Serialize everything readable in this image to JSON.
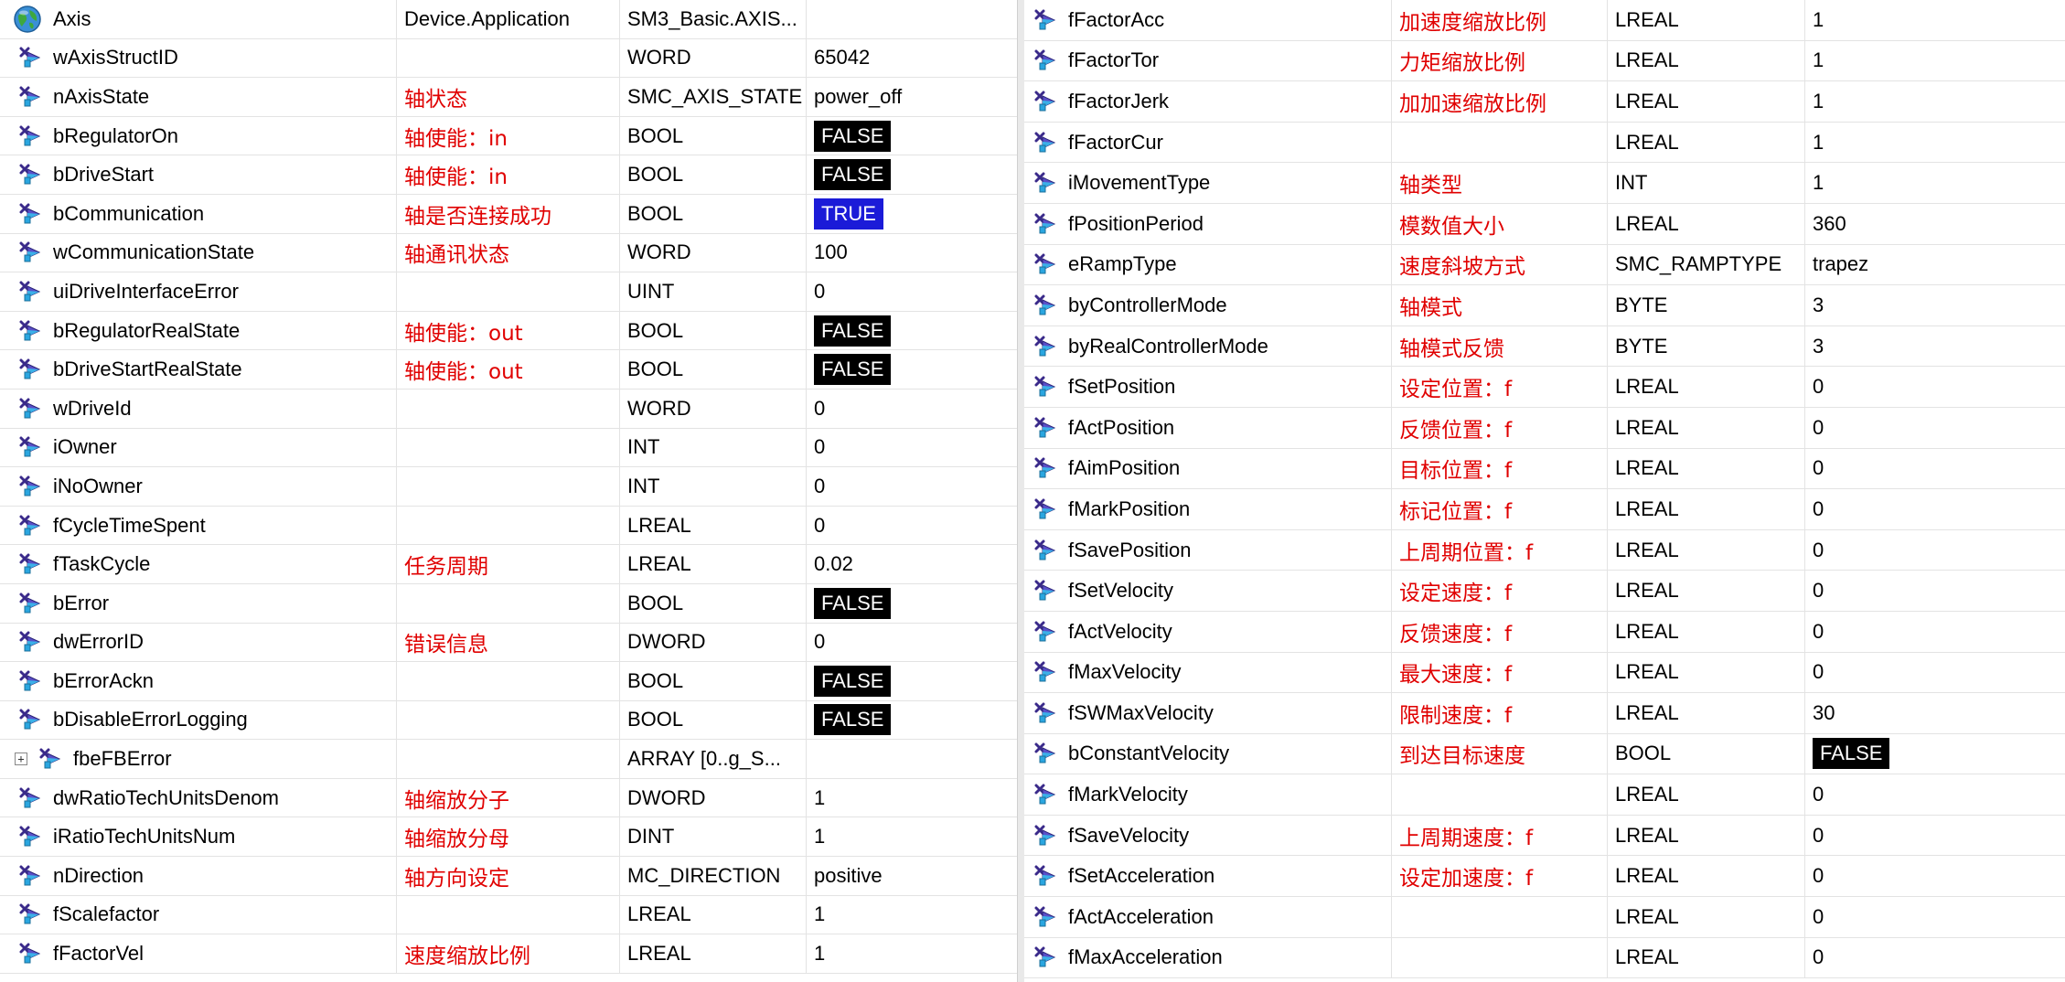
{
  "root": {
    "name": "Axis",
    "comment": "Device.Application",
    "type": "SM3_Basic.AXIS...",
    "value": ""
  },
  "left_rows": [
    {
      "name": "wAxisStructID",
      "comment": "",
      "type": "WORD",
      "value": "65042"
    },
    {
      "name": "nAxisState",
      "comment": "轴状态",
      "type": "SMC_AXIS_STATE",
      "value": "power_off"
    },
    {
      "name": "bRegulatorOn",
      "comment": "轴使能：in",
      "type": "BOOL",
      "value": "FALSE",
      "bool": "false"
    },
    {
      "name": "bDriveStart",
      "comment": "轴使能：in",
      "type": "BOOL",
      "value": "FALSE",
      "bool": "false"
    },
    {
      "name": "bCommunication",
      "comment": "轴是否连接成功",
      "type": "BOOL",
      "value": "TRUE",
      "bool": "true"
    },
    {
      "name": "wCommunicationState",
      "comment": "轴通讯状态",
      "type": "WORD",
      "value": "100"
    },
    {
      "name": "uiDriveInterfaceError",
      "comment": "",
      "type": "UINT",
      "value": "0"
    },
    {
      "name": "bRegulatorRealState",
      "comment": "轴使能：out",
      "type": "BOOL",
      "value": "FALSE",
      "bool": "false"
    },
    {
      "name": "bDriveStartRealState",
      "comment": "轴使能：out",
      "type": "BOOL",
      "value": "FALSE",
      "bool": "false"
    },
    {
      "name": "wDriveId",
      "comment": "",
      "type": "WORD",
      "value": "0"
    },
    {
      "name": "iOwner",
      "comment": "",
      "type": "INT",
      "value": "0"
    },
    {
      "name": "iNoOwner",
      "comment": "",
      "type": "INT",
      "value": "0"
    },
    {
      "name": "fCycleTimeSpent",
      "comment": "",
      "type": "LREAL",
      "value": "0"
    },
    {
      "name": "fTaskCycle",
      "comment": "任务周期",
      "type": "LREAL",
      "value": "0.02"
    },
    {
      "name": "bError",
      "comment": "",
      "type": "BOOL",
      "value": "FALSE",
      "bool": "false"
    },
    {
      "name": "dwErrorID",
      "comment": "错误信息",
      "type": "DWORD",
      "value": "0"
    },
    {
      "name": "bErrorAckn",
      "comment": "",
      "type": "BOOL",
      "value": "FALSE",
      "bool": "false"
    },
    {
      "name": "bDisableErrorLogging",
      "comment": "",
      "type": "BOOL",
      "value": "FALSE",
      "bool": "false"
    },
    {
      "name": "fbeFBError",
      "comment": "",
      "type": "ARRAY [0..g_S...",
      "value": "",
      "expander": "+"
    },
    {
      "name": "dwRatioTechUnitsDenom",
      "comment": "轴缩放分子",
      "type": "DWORD",
      "value": "1"
    },
    {
      "name": "iRatioTechUnitsNum",
      "comment": "轴缩放分母",
      "type": "DINT",
      "value": "1"
    },
    {
      "name": "nDirection",
      "comment": "轴方向设定",
      "type": "MC_DIRECTION",
      "value": "positive"
    },
    {
      "name": "fScalefactor",
      "comment": "",
      "type": "LREAL",
      "value": "1"
    },
    {
      "name": "fFactorVel",
      "comment": "速度缩放比例",
      "type": "LREAL",
      "value": "1"
    }
  ],
  "right_rows": [
    {
      "name": "fFactorAcc",
      "comment": "加速度缩放比例",
      "type": "LREAL",
      "value": "1"
    },
    {
      "name": "fFactorTor",
      "comment": "力矩缩放比例",
      "type": "LREAL",
      "value": "1"
    },
    {
      "name": "fFactorJerk",
      "comment": "加加速缩放比例",
      "type": "LREAL",
      "value": "1"
    },
    {
      "name": "fFactorCur",
      "comment": "",
      "type": "LREAL",
      "value": "1"
    },
    {
      "name": "iMovementType",
      "comment": "轴类型",
      "type": "INT",
      "value": "1"
    },
    {
      "name": "fPositionPeriod",
      "comment": "模数值大小",
      "type": "LREAL",
      "value": "360"
    },
    {
      "name": "eRampType",
      "comment": "速度斜坡方式",
      "type": "SMC_RAMPTYPE",
      "value": "trapez"
    },
    {
      "name": "byControllerMode",
      "comment": "轴模式",
      "type": "BYTE",
      "value": "3"
    },
    {
      "name": "byRealControllerMode",
      "comment": "轴模式反馈",
      "type": "BYTE",
      "value": "3"
    },
    {
      "name": "fSetPosition",
      "comment": "设定位置：f",
      "type": "LREAL",
      "value": "0"
    },
    {
      "name": "fActPosition",
      "comment": "反馈位置：f",
      "type": "LREAL",
      "value": "0"
    },
    {
      "name": "fAimPosition",
      "comment": "目标位置：f",
      "type": "LREAL",
      "value": "0"
    },
    {
      "name": "fMarkPosition",
      "comment": "标记位置：f",
      "type": "LREAL",
      "value": "0"
    },
    {
      "name": "fSavePosition",
      "comment": "上周期位置：f",
      "type": "LREAL",
      "value": "0"
    },
    {
      "name": "fSetVelocity",
      "comment": "设定速度：f",
      "type": "LREAL",
      "value": "0"
    },
    {
      "name": "fActVelocity",
      "comment": "反馈速度：f",
      "type": "LREAL",
      "value": "0"
    },
    {
      "name": "fMaxVelocity",
      "comment": "最大速度：f",
      "type": "LREAL",
      "value": "0"
    },
    {
      "name": "fSWMaxVelocity",
      "comment": "限制速度：f",
      "type": "LREAL",
      "value": "30"
    },
    {
      "name": "bConstantVelocity",
      "comment": "到达目标速度",
      "type": "BOOL",
      "value": "FALSE",
      "bool": "false"
    },
    {
      "name": "fMarkVelocity",
      "comment": "",
      "type": "LREAL",
      "value": "0"
    },
    {
      "name": "fSaveVelocity",
      "comment": "上周期速度：f",
      "type": "LREAL",
      "value": "0"
    },
    {
      "name": "fSetAcceleration",
      "comment": "设定加速度：f",
      "type": "LREAL",
      "value": "0"
    },
    {
      "name": "fActAcceleration",
      "comment": "",
      "type": "LREAL",
      "value": "0"
    },
    {
      "name": "fMaxAcceleration",
      "comment": "",
      "type": "LREAL",
      "value": "0"
    }
  ],
  "icons": {
    "root": "globe-icon",
    "variable": "variable-icon",
    "expander": "expand-plus-icon"
  },
  "colors": {
    "comment_text": "#e00000",
    "bool_false_bg": "#000000",
    "bool_true_bg": "#1b1bd8"
  }
}
